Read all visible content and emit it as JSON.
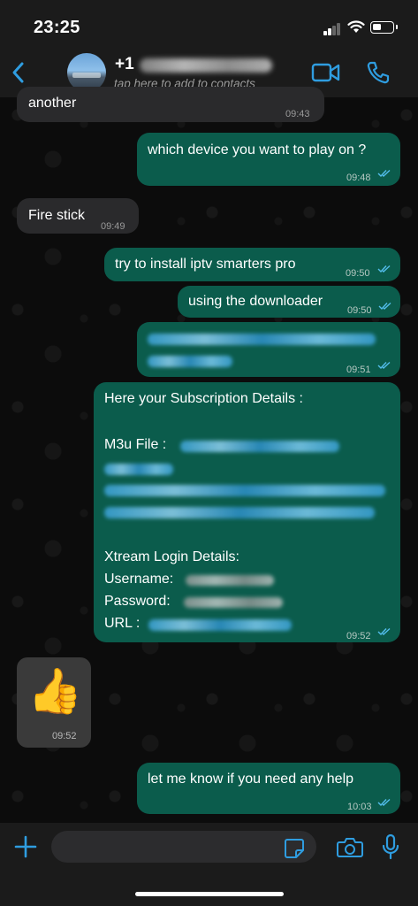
{
  "status_bar": {
    "time": "23:25"
  },
  "header": {
    "back_icon": "chevron-left-icon",
    "contact_name_visible": "+1",
    "subtitle": "tap here to add to contacts",
    "video_icon": "video-call-icon",
    "call_icon": "phone-icon"
  },
  "messages": [
    {
      "direction": "in",
      "text": "another",
      "time": "09:43"
    },
    {
      "direction": "out",
      "text": "which device you want to play on ?",
      "time": "09:48",
      "status": "read"
    },
    {
      "direction": "in",
      "text": "Fire stick",
      "time": "09:49"
    },
    {
      "direction": "out",
      "text": "try to install iptv smarters pro",
      "time": "09:50",
      "status": "read"
    },
    {
      "direction": "out",
      "text": "using the downloader",
      "time": "09:50",
      "status": "read"
    },
    {
      "direction": "out",
      "text": "",
      "time": "09:51",
      "status": "read",
      "redacted": true
    },
    {
      "direction": "out",
      "time": "09:52",
      "status": "read",
      "lines": {
        "heading": "Here your Subscription Details :",
        "m3u_label": "M3u File :",
        "xtream_heading": "Xtream Login Details:",
        "username_label": "Username:",
        "password_label": "Password:",
        "url_label": "URL :"
      }
    },
    {
      "direction": "in",
      "sticker": "thumbs-up",
      "emoji": "👍",
      "time": "09:52"
    },
    {
      "direction": "out",
      "text": "let me know if you need any help",
      "time": "10:03",
      "status": "read"
    }
  ],
  "input_bar": {
    "placeholder": "",
    "plus_icon": "plus-icon",
    "sticker_icon": "sticker-icon",
    "camera_icon": "camera-icon",
    "mic_icon": "microphone-icon"
  },
  "colors": {
    "accent": "#2f9de0",
    "outgoing_bubble": "#0b5c4c",
    "incoming_bubble": "#2a2a2c",
    "read_ticks": "#53bdeb"
  }
}
